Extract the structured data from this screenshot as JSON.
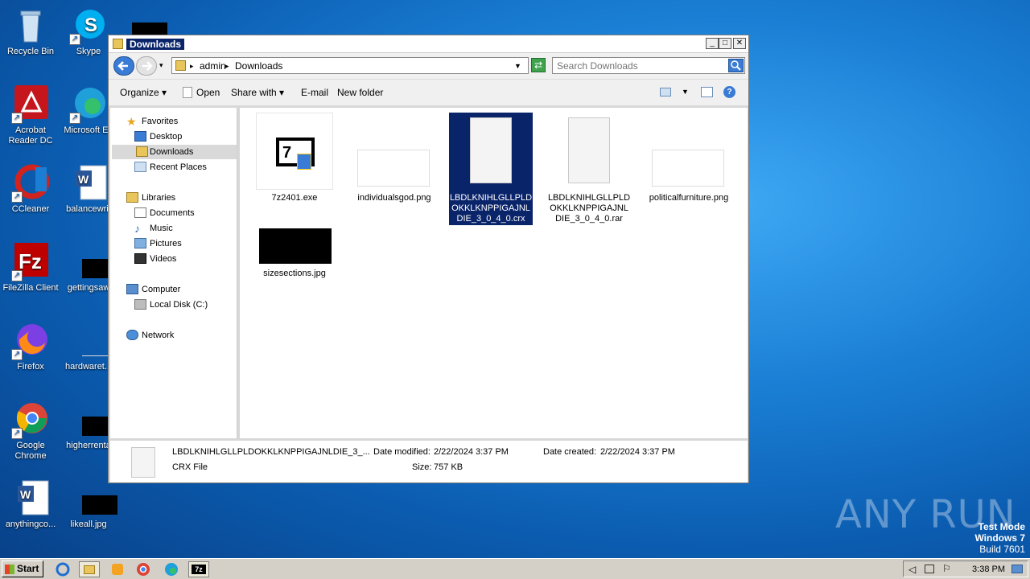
{
  "desktop": {
    "icons": [
      {
        "label": "Recycle Bin"
      },
      {
        "label": "Skype"
      },
      {
        "label": "Acrobat Reader DC"
      },
      {
        "label": "Microsoft Ed"
      },
      {
        "label": "CCleaner"
      },
      {
        "label": "balancewrit"
      },
      {
        "label": "FileZilla Client"
      },
      {
        "label": "gettingsaw"
      },
      {
        "label": "Firefox"
      },
      {
        "label": "hardwaret..."
      },
      {
        "label": "Google Chrome"
      },
      {
        "label": "higherrenta"
      },
      {
        "label": "anythingco..."
      },
      {
        "label": "likeall.jpg"
      }
    ]
  },
  "window": {
    "title": "Downloads",
    "breadcrumb": [
      "admin",
      "Downloads"
    ],
    "search_placeholder": "Search Downloads",
    "toolbar": {
      "organize": "Organize",
      "open": "Open",
      "share_with": "Share with",
      "email": "E-mail",
      "new_folder": "New folder"
    },
    "nav": {
      "favorites": "Favorites",
      "desktop": "Desktop",
      "downloads": "Downloads",
      "recent_places": "Recent Places",
      "libraries": "Libraries",
      "documents": "Documents",
      "music": "Music",
      "pictures": "Pictures",
      "videos": "Videos",
      "computer": "Computer",
      "local_disk": "Local Disk (C:)",
      "network": "Network"
    },
    "files": [
      {
        "name": "7z2401.exe"
      },
      {
        "name": "individualsgod.png"
      },
      {
        "name": "LBDLKNIHLGLLPLDOKKLKNPPIGAJNLDIE_3_0_4_0.crx"
      },
      {
        "name": "LBDLKNIHLGLLPLDOKKLKNPPIGAJNLDIE_3_0_4_0.rar"
      },
      {
        "name": "politicalfurniture.png"
      },
      {
        "name": "sizesections.jpg"
      }
    ],
    "details": {
      "name": "LBDLKNIHLGLLPLDOKKLKNPPIGAJNLDIE_3_...",
      "type": "CRX File",
      "date_modified_label": "Date modified:",
      "date_modified": "2/22/2024 3:37 PM",
      "size_label": "Size:",
      "size": "757 KB",
      "date_created_label": "Date created:",
      "date_created": "2/22/2024 3:37 PM"
    }
  },
  "taskbar": {
    "start": "Start",
    "clock": "3:38 PM"
  },
  "watermark": {
    "line1": "Test Mode",
    "line2": "Windows 7",
    "line3": "Build 7601",
    "brand": "ANY RUN"
  },
  "colors": {
    "selection": "#0a246a",
    "desktop_bg": "#1a7fd4"
  }
}
